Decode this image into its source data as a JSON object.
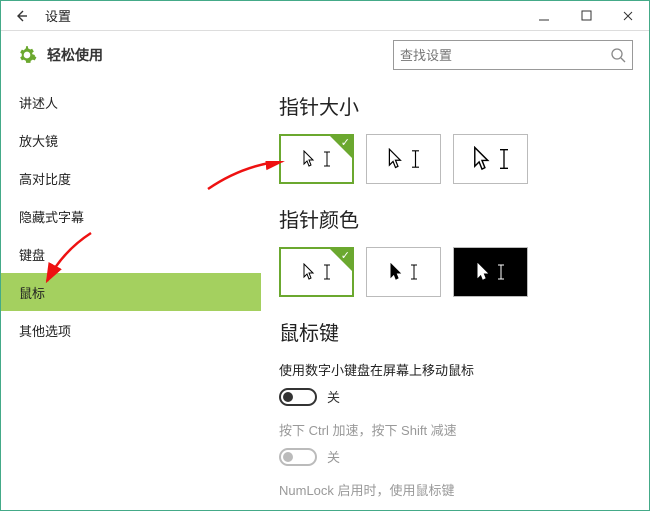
{
  "window": {
    "title": "设置"
  },
  "header": {
    "title": "轻松使用",
    "search_placeholder": "查找设置"
  },
  "sidebar": {
    "items": [
      {
        "label": "讲述人"
      },
      {
        "label": "放大镜"
      },
      {
        "label": "高对比度"
      },
      {
        "label": "隐藏式字幕"
      },
      {
        "label": "键盘"
      },
      {
        "label": "鼠标"
      },
      {
        "label": "其他选项"
      }
    ],
    "active_index": 5
  },
  "content": {
    "sections": {
      "pointer_size": {
        "title": "指针大小"
      },
      "pointer_color": {
        "title": "指针颜色"
      },
      "mouse_keys": {
        "title": "鼠标键",
        "opt1_label": "使用数字小键盘在屏幕上移动鼠标",
        "opt1_state": "关",
        "opt2_label": "按下 Ctrl 加速，按下 Shift 减速",
        "opt2_state": "关",
        "opt3_label": "NumLock 启用时，使用鼠标键"
      }
    }
  }
}
